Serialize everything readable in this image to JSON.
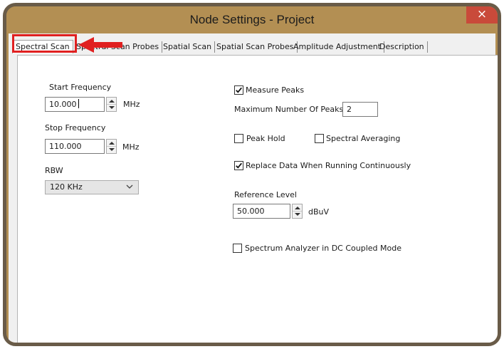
{
  "window": {
    "title": "Node Settings - Project",
    "close_glyph": "×"
  },
  "tabs": [
    {
      "label": "Spectral Scan",
      "active": true
    },
    {
      "label": "Spectral Scan Probes",
      "active": false
    },
    {
      "label": "Spatial Scan",
      "active": false
    },
    {
      "label": "Spatial Scan Probes",
      "active": false
    },
    {
      "label": "Amplitude Adjustment",
      "active": false
    },
    {
      "label": "Description",
      "active": false
    }
  ],
  "annotation": {
    "box_color": "#e02020",
    "arrow_color": "#e02020",
    "arrow_icon": "left-arrow-icon"
  },
  "left": {
    "start_frequency": {
      "label": "Start Frequency",
      "value": "10.000",
      "unit": "MHz"
    },
    "stop_frequency": {
      "label": "Stop Frequency",
      "value": "110.000",
      "unit": "MHz"
    },
    "rbw": {
      "label": "RBW",
      "value": "120 KHz"
    }
  },
  "right": {
    "measure_peaks": {
      "label": "Measure Peaks",
      "checked": true
    },
    "max_peaks": {
      "label": "Maximum Number Of Peaks:",
      "value": "2"
    },
    "peak_hold": {
      "label": "Peak Hold",
      "checked": false
    },
    "spectral_averaging": {
      "label": "Spectral Averaging",
      "checked": false
    },
    "replace_data": {
      "label": "Replace Data When Running Continuously",
      "checked": true
    },
    "reference_level": {
      "label": "Reference Level",
      "value": "50.000",
      "unit": "dBuV"
    },
    "dc_coupled": {
      "label": "Spectrum Analyzer in DC Coupled Mode",
      "checked": false
    }
  },
  "colors": {
    "frame": "#b38f53",
    "frame_border": "#695b48",
    "close_button": "#c94a3a"
  }
}
